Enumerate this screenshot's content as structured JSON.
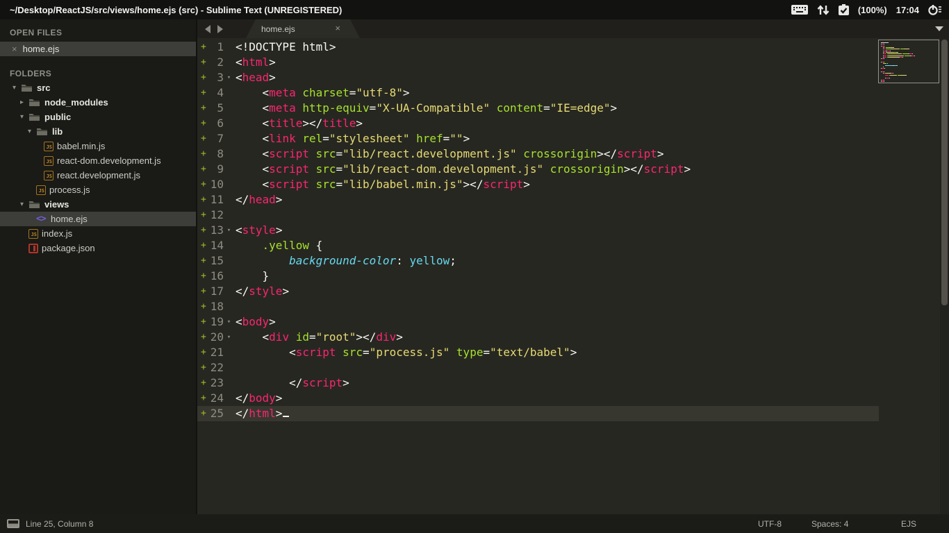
{
  "titlebar": {
    "title": "~/Desktop/ReactJS/src/views/home.ejs (src) - Sublime Text (UNREGISTERED)",
    "tray": {
      "battery": "(100%)",
      "time": "17:04",
      "icons": [
        "keyboard-icon",
        "updown-arrows-icon",
        "battery-check-icon",
        "power-menu-icon"
      ]
    }
  },
  "sidebar": {
    "open_files_header": "OPEN FILES",
    "open_files": [
      {
        "name": "home.ejs"
      }
    ],
    "folders_header": "FOLDERS",
    "tree": [
      {
        "label": "src",
        "type": "folder",
        "depth": 0,
        "state": "expanded",
        "bold": true
      },
      {
        "label": "node_modules",
        "type": "folder",
        "depth": 1,
        "state": "collapsed",
        "bold": true
      },
      {
        "label": "public",
        "type": "folder",
        "depth": 1,
        "state": "expanded",
        "bold": true
      },
      {
        "label": "lib",
        "type": "folder",
        "depth": 2,
        "state": "expanded",
        "bold": true
      },
      {
        "label": "babel.min.js",
        "type": "js",
        "depth": 3
      },
      {
        "label": "react-dom.development.js",
        "type": "js",
        "depth": 3
      },
      {
        "label": "react.development.js",
        "type": "js",
        "depth": 3
      },
      {
        "label": "process.js",
        "type": "js",
        "depth": 2
      },
      {
        "label": "views",
        "type": "folder",
        "depth": 1,
        "state": "expanded",
        "bold": true
      },
      {
        "label": "home.ejs",
        "type": "ejs",
        "depth": 2,
        "selected": true
      },
      {
        "label": "index.js",
        "type": "js",
        "depth": 1
      },
      {
        "label": "package.json",
        "type": "json",
        "depth": 1
      }
    ]
  },
  "tabbar": {
    "tabs": [
      {
        "label": "home.ejs",
        "active": true
      }
    ]
  },
  "editor": {
    "colors": {
      "p": "#d8d8d2",
      "t": "#f92672",
      "a": "#a6e22e",
      "s": "#e6db74",
      "cp": "#66d9ef",
      "cv": "#66d9ef"
    },
    "lines": [
      {
        "num": 1,
        "tokens": [
          [
            "p",
            "<!DOCTYPE html>"
          ]
        ]
      },
      {
        "num": 2,
        "tokens": [
          [
            "p",
            "<"
          ],
          [
            "t",
            "html"
          ],
          [
            "p",
            ">"
          ]
        ]
      },
      {
        "num": 3,
        "fold": true,
        "tokens": [
          [
            "p",
            "<"
          ],
          [
            "t",
            "head"
          ],
          [
            "p",
            ">"
          ]
        ]
      },
      {
        "num": 4,
        "tokens": [
          [
            "p",
            "    <"
          ],
          [
            "t",
            "meta"
          ],
          [
            "p",
            " "
          ],
          [
            "a",
            "charset"
          ],
          [
            "p",
            "="
          ],
          [
            "s",
            "\"utf-8\""
          ],
          [
            "p",
            ">"
          ]
        ]
      },
      {
        "num": 5,
        "tokens": [
          [
            "p",
            "    <"
          ],
          [
            "t",
            "meta"
          ],
          [
            "p",
            " "
          ],
          [
            "a",
            "http-equiv"
          ],
          [
            "p",
            "="
          ],
          [
            "s",
            "\"X-UA-Compatible\""
          ],
          [
            "p",
            " "
          ],
          [
            "a",
            "content"
          ],
          [
            "p",
            "="
          ],
          [
            "s",
            "\"IE=edge\""
          ],
          [
            "p",
            ">"
          ]
        ]
      },
      {
        "num": 6,
        "tokens": [
          [
            "p",
            "    <"
          ],
          [
            "t",
            "title"
          ],
          [
            "p",
            "></"
          ],
          [
            "t",
            "title"
          ],
          [
            "p",
            ">"
          ]
        ]
      },
      {
        "num": 7,
        "tokens": [
          [
            "p",
            "    <"
          ],
          [
            "t",
            "link"
          ],
          [
            "p",
            " "
          ],
          [
            "a",
            "rel"
          ],
          [
            "p",
            "="
          ],
          [
            "s",
            "\"stylesheet\""
          ],
          [
            "p",
            " "
          ],
          [
            "a",
            "href"
          ],
          [
            "p",
            "="
          ],
          [
            "s",
            "\"\""
          ],
          [
            "p",
            ">"
          ]
        ]
      },
      {
        "num": 8,
        "tokens": [
          [
            "p",
            "    <"
          ],
          [
            "t",
            "script"
          ],
          [
            "p",
            " "
          ],
          [
            "a",
            "src"
          ],
          [
            "p",
            "="
          ],
          [
            "s",
            "\"lib/react.development.js\""
          ],
          [
            "p",
            " "
          ],
          [
            "a",
            "crossorigin"
          ],
          [
            "p",
            "></"
          ],
          [
            "t",
            "script"
          ],
          [
            "p",
            ">"
          ]
        ]
      },
      {
        "num": 9,
        "tokens": [
          [
            "p",
            "    <"
          ],
          [
            "t",
            "script"
          ],
          [
            "p",
            " "
          ],
          [
            "a",
            "src"
          ],
          [
            "p",
            "="
          ],
          [
            "s",
            "\"lib/react-dom.development.js\""
          ],
          [
            "p",
            " "
          ],
          [
            "a",
            "crossorigin"
          ],
          [
            "p",
            "></"
          ],
          [
            "t",
            "script"
          ],
          [
            "p",
            ">"
          ]
        ]
      },
      {
        "num": 10,
        "tokens": [
          [
            "p",
            "    <"
          ],
          [
            "t",
            "script"
          ],
          [
            "p",
            " "
          ],
          [
            "a",
            "src"
          ],
          [
            "p",
            "="
          ],
          [
            "s",
            "\"lib/babel.min.js\""
          ],
          [
            "p",
            "></"
          ],
          [
            "t",
            "script"
          ],
          [
            "p",
            ">"
          ]
        ]
      },
      {
        "num": 11,
        "tokens": [
          [
            "p",
            "</"
          ],
          [
            "t",
            "head"
          ],
          [
            "p",
            ">"
          ]
        ]
      },
      {
        "num": 12,
        "tokens": []
      },
      {
        "num": 13,
        "fold": true,
        "tokens": [
          [
            "p",
            "<"
          ],
          [
            "t",
            "style"
          ],
          [
            "p",
            ">"
          ]
        ]
      },
      {
        "num": 14,
        "tokens": [
          [
            "p",
            "    "
          ],
          [
            "a",
            ".yellow"
          ],
          [
            "p",
            " {"
          ]
        ]
      },
      {
        "num": 15,
        "tokens": [
          [
            "p",
            "        "
          ],
          [
            "cp",
            "background-color"
          ],
          [
            "p",
            ": "
          ],
          [
            "cv",
            "yellow"
          ],
          [
            "p",
            ";"
          ]
        ]
      },
      {
        "num": 16,
        "tokens": [
          [
            "p",
            "    }"
          ]
        ]
      },
      {
        "num": 17,
        "tokens": [
          [
            "p",
            "</"
          ],
          [
            "t",
            "style"
          ],
          [
            "p",
            ">"
          ]
        ]
      },
      {
        "num": 18,
        "tokens": []
      },
      {
        "num": 19,
        "fold": true,
        "tokens": [
          [
            "p",
            "<"
          ],
          [
            "t",
            "body"
          ],
          [
            "p",
            ">"
          ]
        ]
      },
      {
        "num": 20,
        "fold": true,
        "tokens": [
          [
            "p",
            "    <"
          ],
          [
            "t",
            "div"
          ],
          [
            "p",
            " "
          ],
          [
            "a",
            "id"
          ],
          [
            "p",
            "="
          ],
          [
            "s",
            "\"root\""
          ],
          [
            "p",
            "></"
          ],
          [
            "t",
            "div"
          ],
          [
            "p",
            ">"
          ]
        ]
      },
      {
        "num": 21,
        "tokens": [
          [
            "p",
            "        <"
          ],
          [
            "t",
            "script"
          ],
          [
            "p",
            " "
          ],
          [
            "a",
            "src"
          ],
          [
            "p",
            "="
          ],
          [
            "s",
            "\"process.js\""
          ],
          [
            "p",
            " "
          ],
          [
            "a",
            "type"
          ],
          [
            "p",
            "="
          ],
          [
            "s",
            "\"text/babel\""
          ],
          [
            "p",
            ">"
          ]
        ]
      },
      {
        "num": 22,
        "tokens": []
      },
      {
        "num": 23,
        "tokens": [
          [
            "p",
            "        </"
          ],
          [
            "t",
            "script"
          ],
          [
            "p",
            ">"
          ]
        ]
      },
      {
        "num": 24,
        "tokens": [
          [
            "p",
            "</"
          ],
          [
            "t",
            "body"
          ],
          [
            "p",
            ">"
          ]
        ]
      },
      {
        "num": 25,
        "current": true,
        "cursor": true,
        "tokens": [
          [
            "p",
            "</"
          ],
          [
            "t",
            "html"
          ],
          [
            "p",
            ">"
          ]
        ]
      }
    ]
  },
  "statusbar": {
    "position": "Line 25, Column 8",
    "encoding": "UTF-8",
    "indent": "Spaces: 4",
    "syntax": "EJS"
  }
}
